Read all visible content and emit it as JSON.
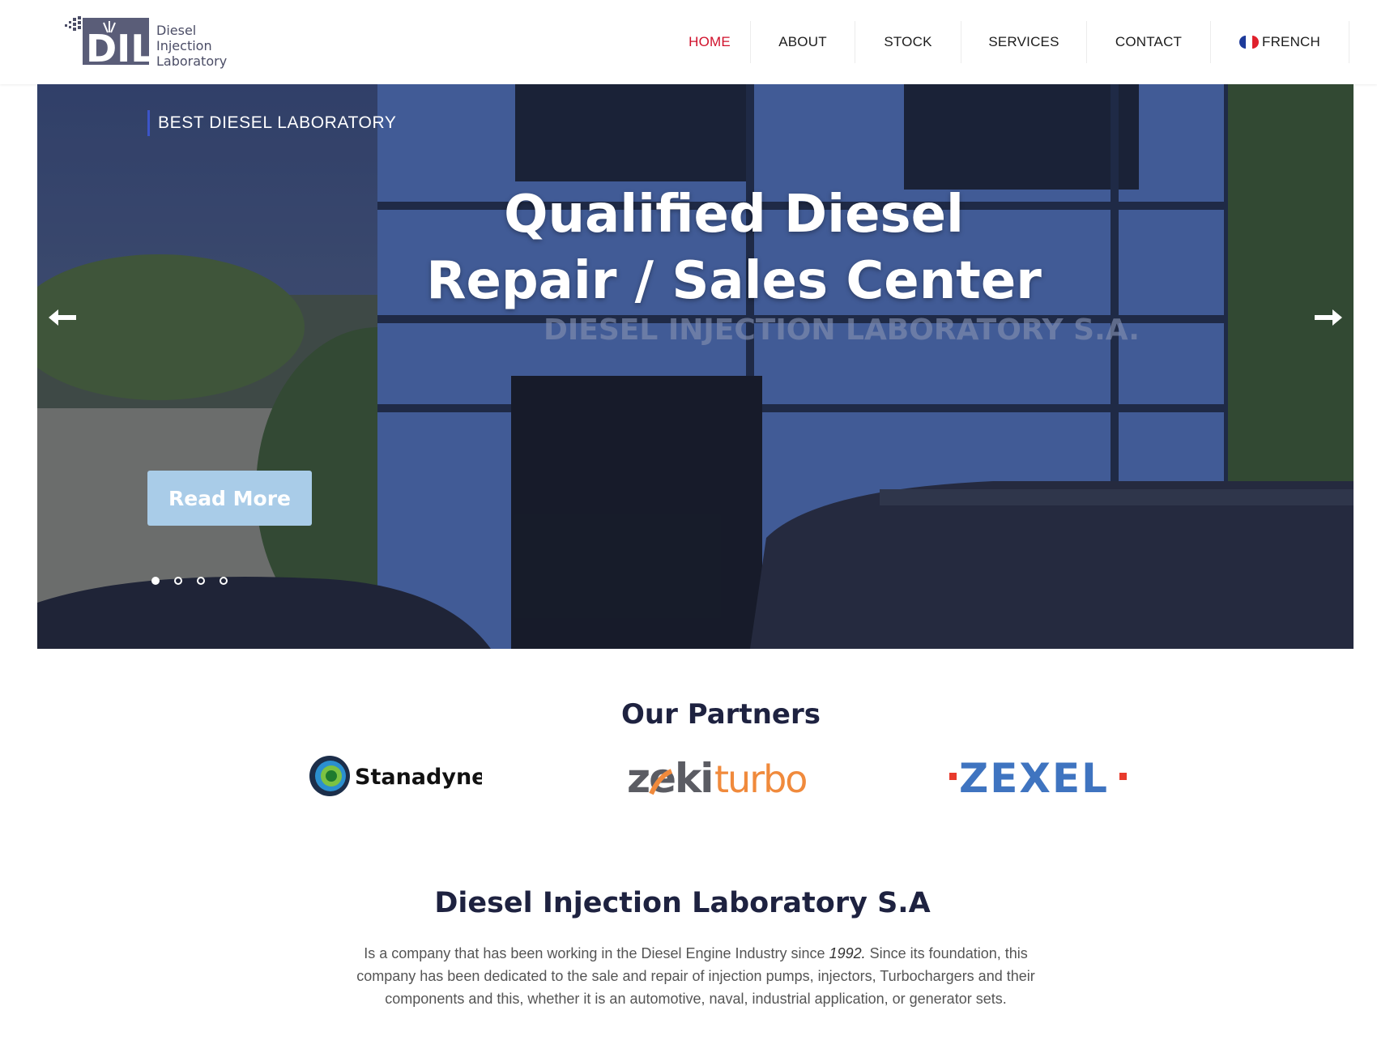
{
  "logo": {
    "name": "DIL",
    "lines": [
      "Diesel",
      "Injection",
      "Laboratory"
    ]
  },
  "nav": {
    "items": [
      {
        "label": "HOME",
        "active": true
      },
      {
        "label": "ABOUT",
        "active": false
      },
      {
        "label": "STOCK",
        "active": false
      },
      {
        "label": "SERVICES",
        "active": false
      },
      {
        "label": "CONTACT",
        "active": false
      }
    ],
    "language": "FRENCH"
  },
  "hero": {
    "tagline": "BEST DIESEL LABORATORY",
    "title": "Qualified Diesel Repair / Sales Center",
    "button": "Read More",
    "slide_count": 4,
    "active_slide": 1,
    "building_sign": "DIESEL INJECTION LABORATORY S.A."
  },
  "partners": {
    "title": "Our Partners",
    "logos": [
      "Stanadyne",
      "zekiturbo",
      "ZEXEL"
    ]
  },
  "about": {
    "title": "Diesel Injection Laboratory S.A",
    "text_before": "Is a company that has been working in the Diesel Engine Industry since ",
    "year": "1992.",
    "text_after": " Since its foundation, this company has been dedicated to the sale and repair of injection pumps, injectors, Turbochargers and their components and this, whether it is an automotive, naval, industrial application, or generator sets."
  },
  "colors": {
    "accent_red": "#d0112b",
    "heading_navy": "#1e2240",
    "button_blue": "#a9cce8",
    "logo_slate": "#4b4d66"
  }
}
